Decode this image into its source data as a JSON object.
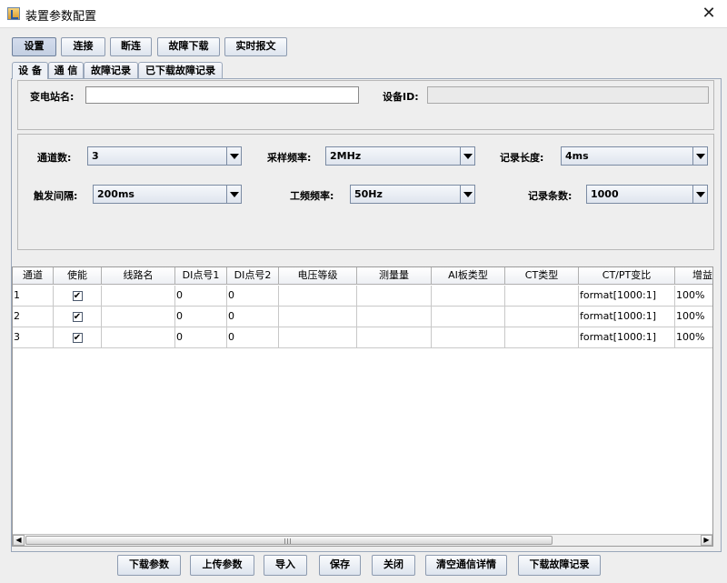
{
  "window": {
    "title": "装置参数配置"
  },
  "toolbar": [
    "设置",
    "连接",
    "断连",
    "故障下载",
    "实时报文"
  ],
  "tabs": [
    "设 备",
    "通 信",
    "故障记录",
    "已下载故障记录"
  ],
  "station": {
    "name_label": "变电站名:",
    "name_value": "",
    "device_label": "设备ID:",
    "device_value": ""
  },
  "params": {
    "channels_label": "通道数:",
    "channels_value": "3",
    "sample_label": "采样频率:",
    "sample_value": "2MHz",
    "rec_len_label": "记录长度:",
    "rec_len_value": "4ms",
    "trigger_label": "触发间隔:",
    "trigger_value": "200ms",
    "freq_label": "工频频率:",
    "freq_value": "50Hz",
    "rec_count_label": "记录条数:",
    "rec_count_value": "1000"
  },
  "table": {
    "columns": [
      "通道",
      "使能",
      "线路名",
      "DI点号1",
      "DI点号2",
      "电压等级",
      "测量量",
      "AI板类型",
      "CT类型",
      "CT/PT变比",
      "增益"
    ],
    "rows": [
      {
        "channel": "1",
        "enabled": "✔",
        "line": "",
        "di1": "0",
        "di2": "0",
        "voltage": "",
        "measure": "",
        "ai": "",
        "ct": "",
        "ratio": "format[1000:1]",
        "gain": "100%"
      },
      {
        "channel": "2",
        "enabled": "✔",
        "line": "",
        "di1": "0",
        "di2": "0",
        "voltage": "",
        "measure": "",
        "ai": "",
        "ct": "",
        "ratio": "format[1000:1]",
        "gain": "100%"
      },
      {
        "channel": "3",
        "enabled": "✔",
        "line": "",
        "di1": "0",
        "di2": "0",
        "voltage": "",
        "measure": "",
        "ai": "",
        "ct": "",
        "ratio": "format[1000:1]",
        "gain": "100%"
      }
    ]
  },
  "bottom_buttons": [
    "下载参数",
    "上传参数",
    "导入",
    "保存",
    "关闭",
    "清空通信详情",
    "下载故障记录"
  ]
}
